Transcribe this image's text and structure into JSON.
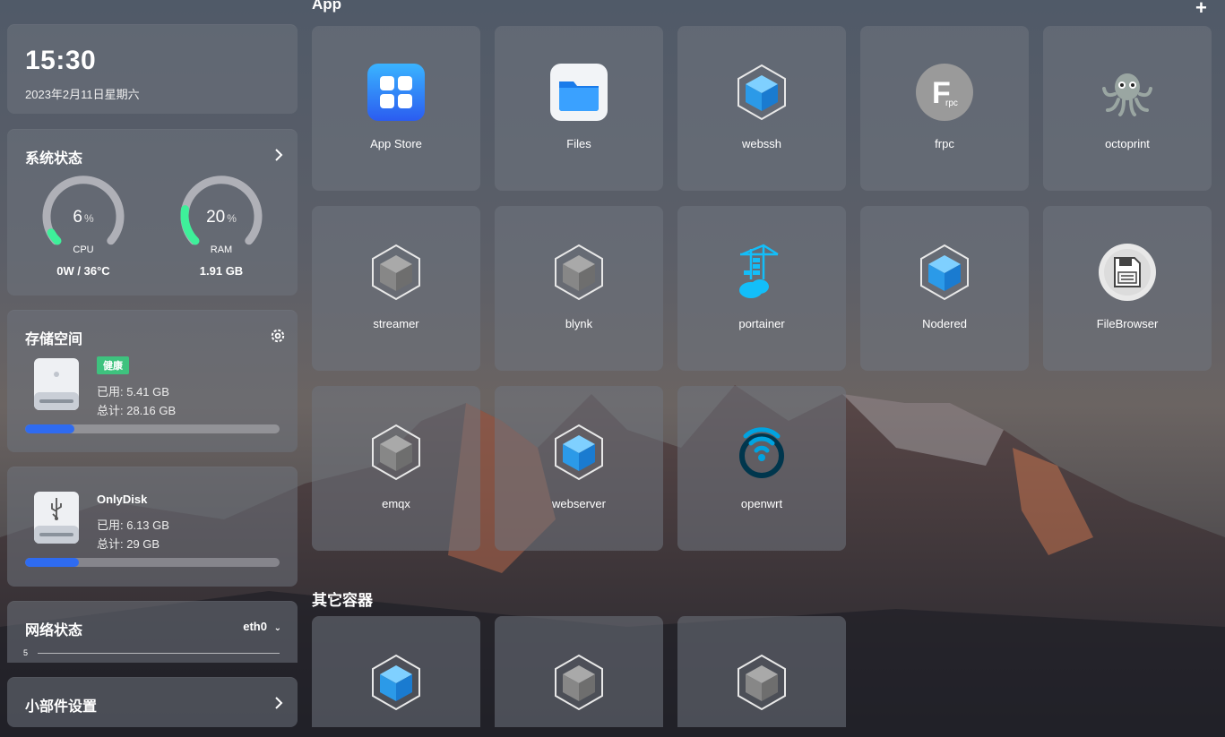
{
  "clock": {
    "time": "15:30",
    "date": "2023年2月11日星期六"
  },
  "system": {
    "title": "系统状态",
    "cpu": {
      "value": "6",
      "unit": "%",
      "label": "CPU",
      "sub": "0W / 36°C",
      "percent": 6
    },
    "ram": {
      "value": "20",
      "unit": "%",
      "label": "RAM",
      "sub": "1.91 GB",
      "percent": 20
    }
  },
  "storage": {
    "title": "存储空间",
    "disk": {
      "badge": "健康",
      "used": "已用: 5.41 GB",
      "total": "总计: 28.16 GB",
      "fraction": 0.192
    },
    "usb": {
      "name": "OnlyDisk",
      "used": "已用: 6.13 GB",
      "total": "总计: 29 GB",
      "fraction": 0.211
    }
  },
  "network": {
    "title": "网络状态",
    "interface": "eth0",
    "scale": "5"
  },
  "widget_settings": {
    "title": "小部件设置"
  },
  "apps_section": {
    "title": "App",
    "add": "+"
  },
  "apps": [
    {
      "name": "App Store",
      "icon": "app-store-icon"
    },
    {
      "name": "Files",
      "icon": "files-icon"
    },
    {
      "name": "webssh",
      "icon": "container-blue-icon"
    },
    {
      "name": "frpc",
      "icon": "frpc-icon"
    },
    {
      "name": "octoprint",
      "icon": "octoprint-icon"
    },
    {
      "name": "streamer",
      "icon": "container-grey-icon"
    },
    {
      "name": "blynk",
      "icon": "container-grey-icon"
    },
    {
      "name": "portainer",
      "icon": "portainer-icon"
    },
    {
      "name": "Nodered",
      "icon": "container-blue-icon"
    },
    {
      "name": "FileBrowser",
      "icon": "filebrowser-icon"
    },
    {
      "name": "emqx",
      "icon": "container-grey-icon"
    },
    {
      "name": "webserver",
      "icon": "container-blue-icon"
    },
    {
      "name": "openwrt",
      "icon": "openwrt-icon"
    }
  ],
  "other_section": {
    "title": "其它容器"
  },
  "others": [
    {
      "icon": "container-blue-icon"
    },
    {
      "icon": "container-grey-icon"
    },
    {
      "icon": "container-grey-icon"
    }
  ],
  "colors": {
    "accent_blue": "#2f6bf0",
    "healthy_green": "#3ec27e",
    "gauge_green": "#3ef09a"
  }
}
